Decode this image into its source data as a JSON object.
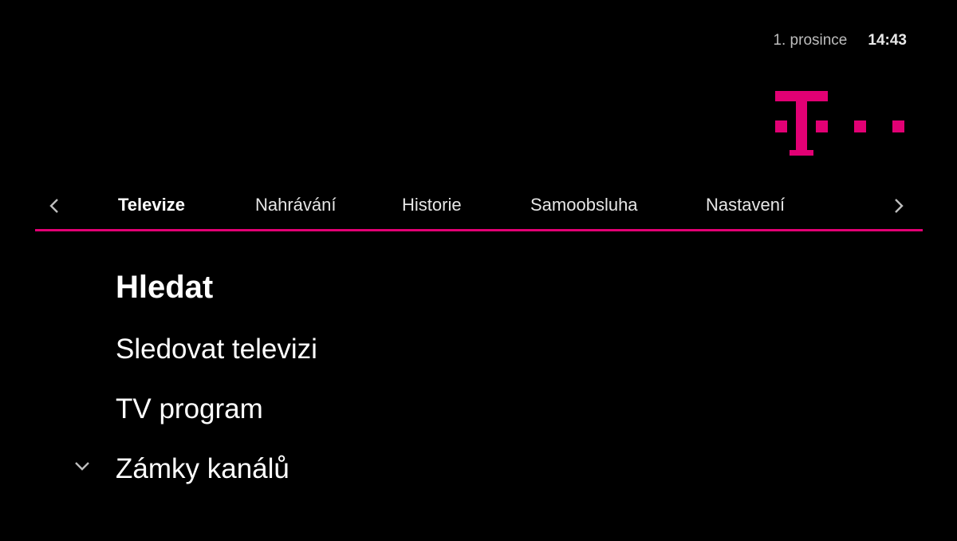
{
  "status": {
    "date": "1. prosince",
    "time": "14:43"
  },
  "brand": {
    "logo_icon": "telekom-logo-icon",
    "accent_color": "#e20074"
  },
  "nav": {
    "prev_icon": "chevron-left-icon",
    "next_icon": "chevron-right-icon",
    "tabs": [
      {
        "label": "Televize",
        "active": true
      },
      {
        "label": "Nahrávání",
        "active": false
      },
      {
        "label": "Historie",
        "active": false
      },
      {
        "label": "Samoobsluha",
        "active": false
      },
      {
        "label": "Nastavení",
        "active": false
      }
    ]
  },
  "menu": {
    "items": [
      {
        "label": "Hledat",
        "active": true
      },
      {
        "label": "Sledovat televizi",
        "active": false
      },
      {
        "label": "TV program",
        "active": false
      },
      {
        "label": "Zámky kanálů",
        "active": false,
        "expand_icon": "chevron-down-icon"
      }
    ]
  }
}
